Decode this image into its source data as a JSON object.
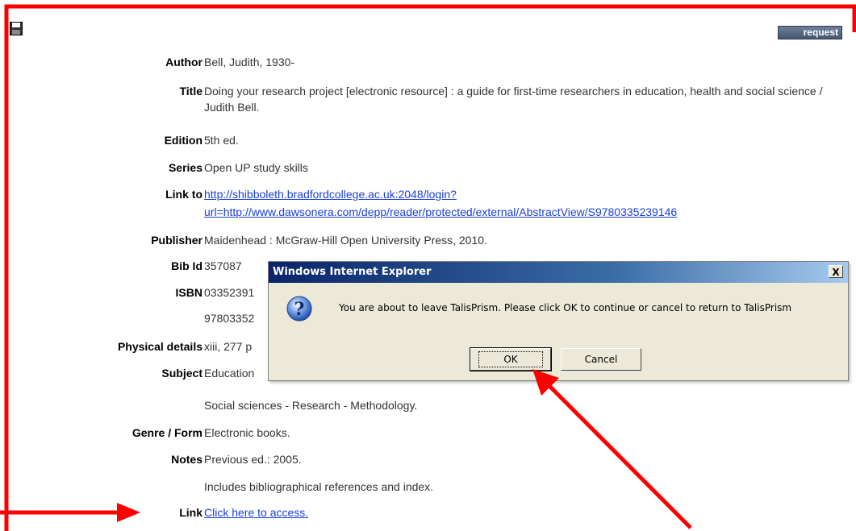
{
  "toolbar": {
    "request_label": "request"
  },
  "record": [
    {
      "label": "Author",
      "value": "Bell, Judith, 1930-"
    },
    {
      "label": "Title",
      "value": "Doing your research project [electronic resource] : a guide for first-time researchers in education, health and social science / Judith Bell."
    },
    {
      "label": "Edition",
      "value": "5th ed."
    },
    {
      "label": "Series",
      "value": "Open UP study skills"
    },
    {
      "label": "Link to",
      "value_line1": "http://shibboleth.bradfordcollege.ac.uk:2048/login?",
      "value_line2": "url=http://www.dawsonera.com/depp/reader/protected/external/AbstractView/S9780335239146"
    },
    {
      "label": "Publisher",
      "value": "Maidenhead : McGraw-Hill Open University Press, 2010."
    },
    {
      "label": "Bib Id",
      "value": "357087"
    },
    {
      "label": "ISBN",
      "value": "03352391",
      "value2": "97803352"
    },
    {
      "label": "Physical details",
      "value": "xiii, 277 p"
    },
    {
      "label": "Subject",
      "value": "Education",
      "value2": "Social sciences - Research - Methodology."
    },
    {
      "label": "Genre / Form",
      "value": "Electronic books."
    },
    {
      "label": "Notes",
      "value": "Previous ed.: 2005.",
      "value2": "Includes bibliographical references and index."
    },
    {
      "label": "Link",
      "value": "Click here to access."
    }
  ],
  "dialog": {
    "title": "Windows Internet Explorer",
    "close_label": "X",
    "message": "You are about to leave TalisPrism. Please click OK to continue or cancel to return to TalisPrism",
    "ok_label": "OK",
    "cancel_label": "Cancel",
    "icon": "question-icon"
  },
  "colors": {
    "annotation": "#ff0000",
    "link": "#1a3fd8",
    "dialog_title": "#0a246a"
  }
}
